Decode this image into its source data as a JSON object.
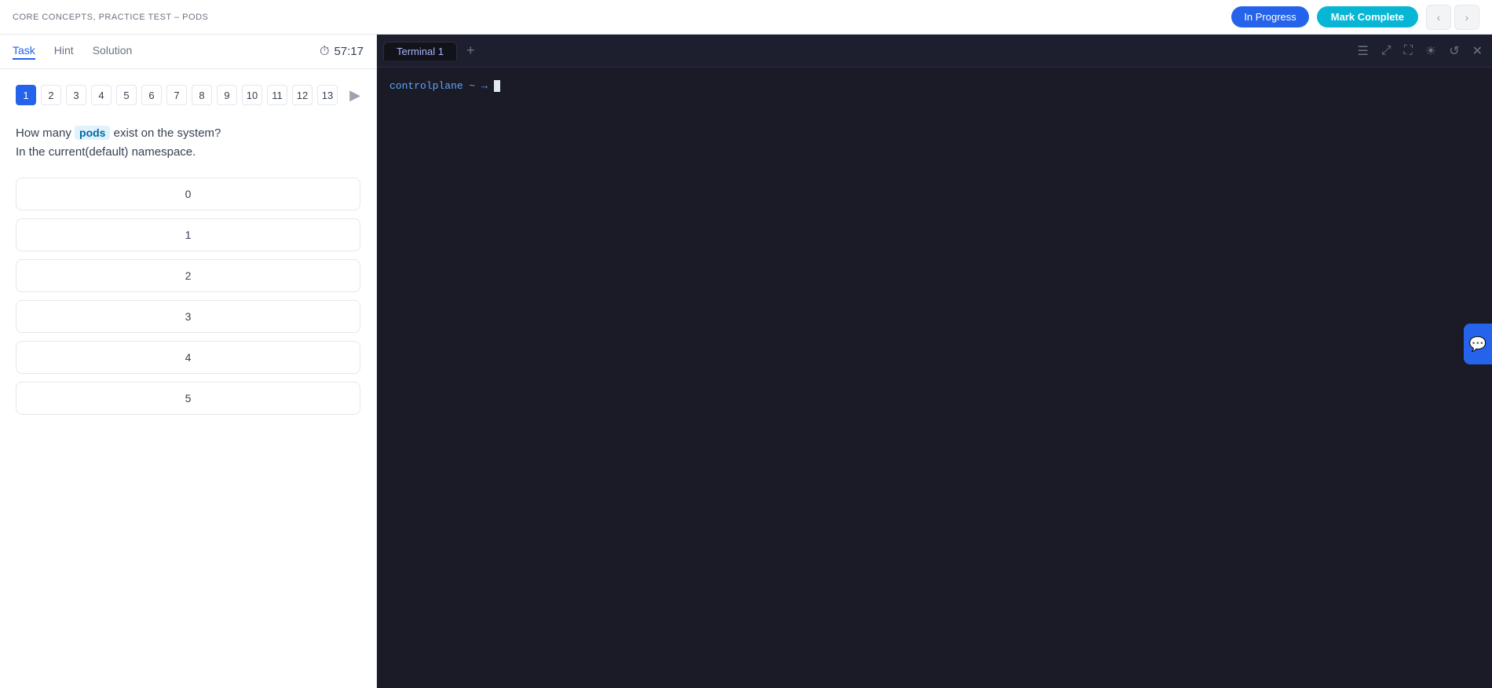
{
  "header": {
    "breadcrumb": "CORE CONCEPTS, PRACTICE TEST – PODS",
    "btn_in_progress": "In Progress",
    "btn_mark_complete": "Mark Complete",
    "nav_prev": "‹",
    "nav_next": "›"
  },
  "tabs": {
    "task": "Task",
    "hint": "Hint",
    "solution": "Solution",
    "active": "task"
  },
  "timer": {
    "icon": "⏱",
    "value": "57:17"
  },
  "questions": {
    "numbers": [
      "1",
      "2",
      "3",
      "4",
      "5",
      "6",
      "7",
      "8",
      "9",
      "10",
      "11",
      "12",
      "13"
    ],
    "active": 1
  },
  "question": {
    "text_before": "How many ",
    "highlight": "pods",
    "text_after": " exist on the system?",
    "subtext": "In the current(default) namespace.",
    "answers": [
      "0",
      "1",
      "2",
      "3",
      "4",
      "5"
    ]
  },
  "terminal": {
    "tab_label": "Terminal 1",
    "add_tab": "+",
    "prompt": "controlplane ~ → ",
    "cursor_char": ""
  },
  "toolbar_icons": {
    "menu": "☰",
    "external": "⤢",
    "fullscreen": "⛶",
    "brightness": "☀",
    "history": "↺",
    "close": "✕"
  },
  "chat_icon": "💬"
}
